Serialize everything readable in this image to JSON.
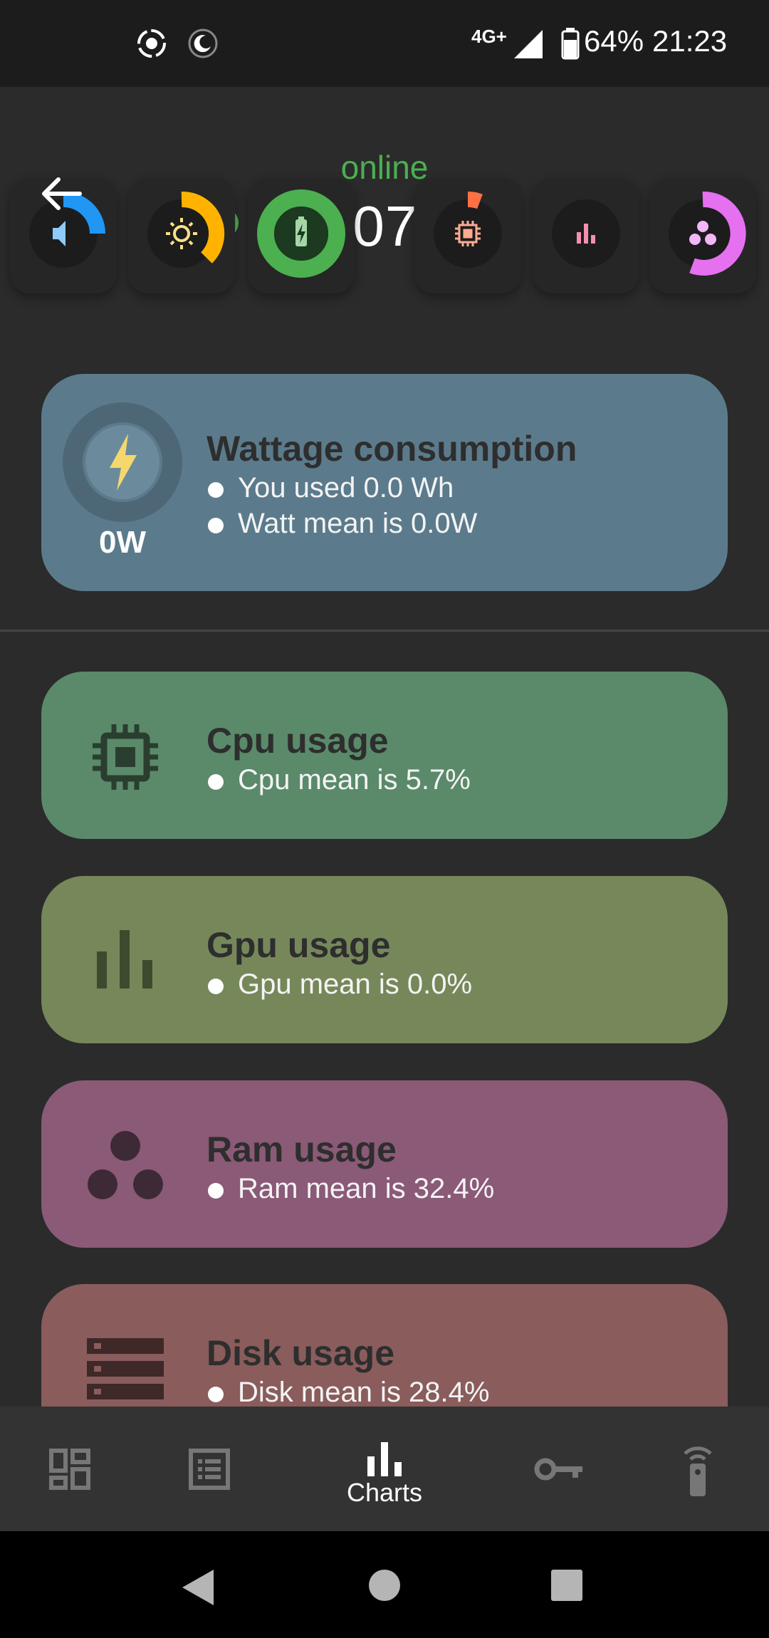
{
  "status_bar": {
    "network": "4G+",
    "battery": "64%",
    "time": "21:23",
    "icons": [
      "screen-record-icon",
      "do-not-disturb-icon",
      "signal-icon",
      "battery-icon"
    ]
  },
  "header": {
    "status": "online",
    "hostname": "i7-10750H",
    "status_color": "#4caf50"
  },
  "gauges": [
    {
      "name": "volume",
      "icon": "volume-icon",
      "color": "#2196f3",
      "level": 0.3
    },
    {
      "name": "brightness",
      "icon": "sun-icon",
      "color": "#ffb300",
      "level": 0.4
    },
    {
      "name": "battery",
      "icon": "battery-charging-icon",
      "color": "#4caf50",
      "level": 1.0
    },
    {
      "name": "cpu",
      "icon": "cpu-icon",
      "color": "#ff7043",
      "level": 0.06
    },
    {
      "name": "gpu",
      "icon": "gpu-icon",
      "color": "#f48fb1",
      "level": 0.0
    },
    {
      "name": "ram",
      "icon": "ram-icon",
      "color": "#e570f0",
      "level": 0.5
    }
  ],
  "cards": {
    "wattage": {
      "title": "Wattage consumption",
      "lines": [
        "You used 0.0 Wh",
        "Watt mean is  0.0W"
      ],
      "value": "0W",
      "color": "#5b7b8c"
    },
    "cpu": {
      "title": "Cpu usage",
      "line": "Cpu mean is 5.7%",
      "color": "#5a8a6a"
    },
    "gpu": {
      "title": "Gpu usage",
      "line": "Gpu mean is 0.0%",
      "color": "#76885a"
    },
    "ram": {
      "title": "Ram usage",
      "line": "Ram mean is 32.4%",
      "color": "#8a5a77"
    },
    "disk": {
      "title": "Disk usage",
      "line": "Disk mean is 28.4%",
      "color": "#8a5c5c"
    }
  },
  "bottom_nav": {
    "items": [
      {
        "name": "dashboard",
        "icon": "dashboard-icon",
        "label": ""
      },
      {
        "name": "list",
        "icon": "list-icon",
        "label": ""
      },
      {
        "name": "charts",
        "icon": "charts-icon",
        "label": "Charts",
        "active": true
      },
      {
        "name": "keys",
        "icon": "key-icon",
        "label": ""
      },
      {
        "name": "remote",
        "icon": "remote-icon",
        "label": ""
      }
    ]
  },
  "system_nav": [
    "back-icon",
    "home-icon",
    "recents-icon"
  ]
}
